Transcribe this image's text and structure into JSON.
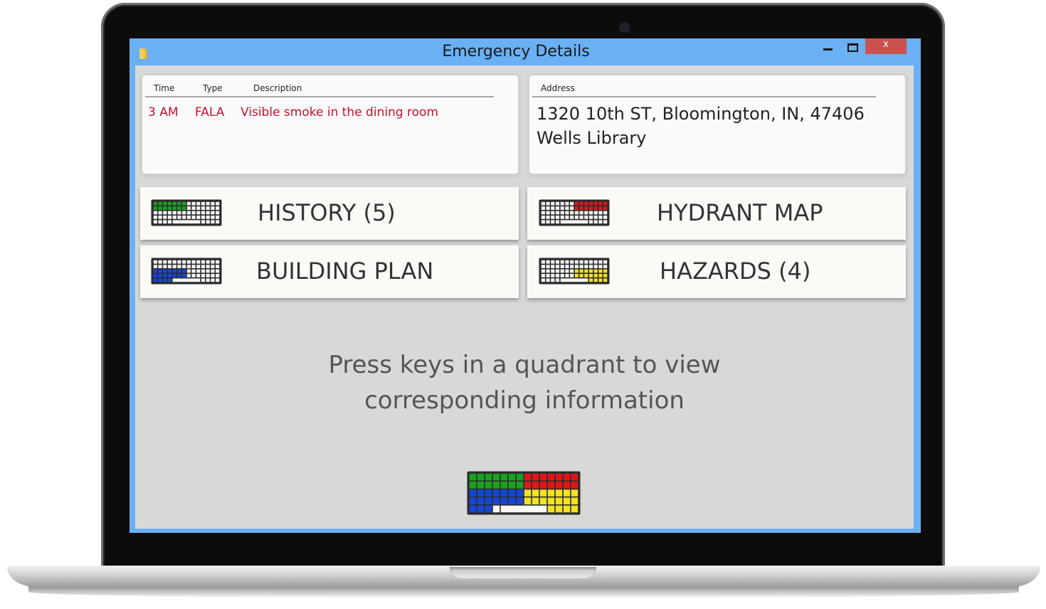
{
  "window": {
    "title": "Emergency Details",
    "controls": {
      "close": "x"
    }
  },
  "incident": {
    "headers": {
      "time": "Time",
      "type": "Type",
      "description": "Description"
    },
    "time": "3 AM",
    "type": "FALA",
    "description": "Visible smoke in the dining room"
  },
  "location": {
    "header": "Address",
    "address_line": "1320 10th ST, Bloomington, IN, 47406",
    "building": "Wells Library"
  },
  "quadrants": [
    {
      "label": "HISTORY (5)",
      "region": "top-left",
      "color": "#17a31e"
    },
    {
      "label": "HYDRANT MAP",
      "region": "top-right",
      "color": "#e0161b"
    },
    {
      "label": "BUILDING PLAN",
      "region": "bottom-left",
      "color": "#1547d6"
    },
    {
      "label": "HAZARDS (4)",
      "region": "bottom-right",
      "color": "#f3e223"
    }
  ],
  "hint": {
    "line1": "Press keys in a quadrant to view",
    "line2": "corresponding information"
  },
  "colors": {
    "window_frame": "#6ab0f5",
    "client_bg": "#d8d8d8",
    "incident_text": "#c8102e",
    "close_button": "#c9524e"
  }
}
